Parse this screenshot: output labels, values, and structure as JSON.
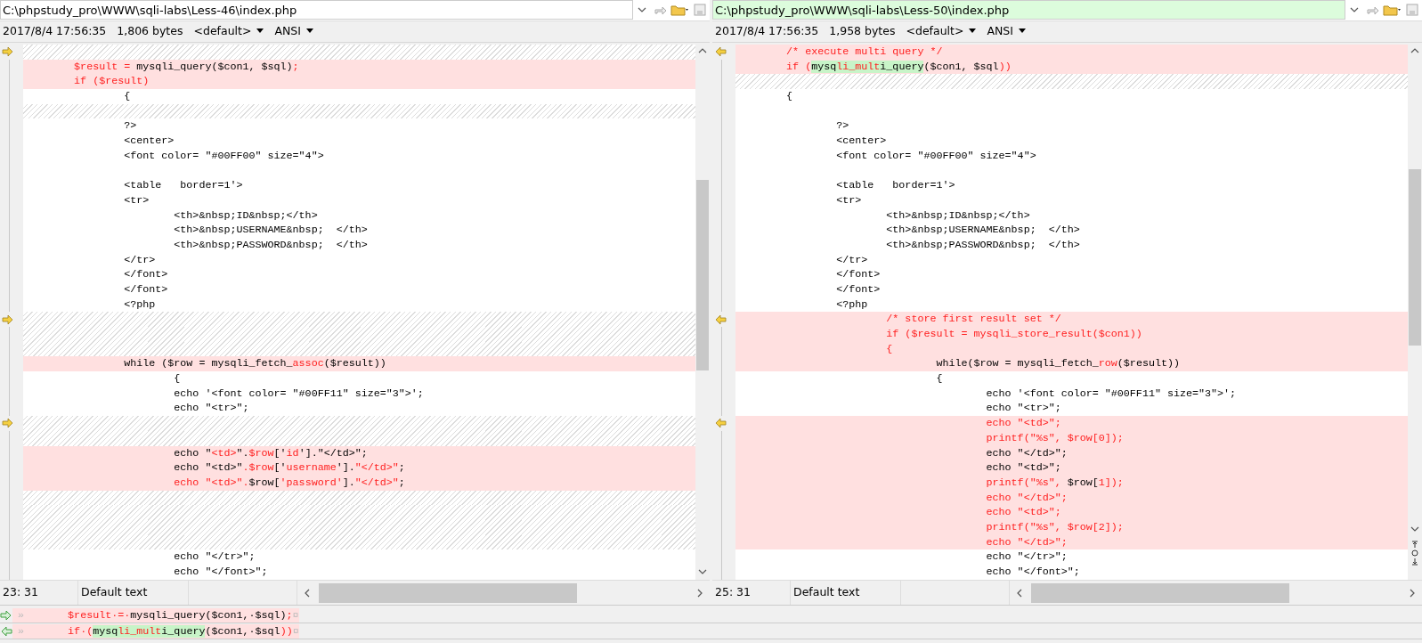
{
  "panes": [
    {
      "path": "C:\\phpstudy_pro\\WWW\\sqli-labs\\Less-46\\index.php",
      "active": false,
      "date": "2017/8/4 17:56:35",
      "size": "1,806 bytes",
      "eol": "<default>",
      "encoding": "ANSI",
      "position": "23: 31",
      "style": "Default text",
      "lines": [
        {
          "kind": "gap",
          "marker": true
        },
        {
          "kind": "diff",
          "marker": false,
          "segments": [
            {
              "text": "\t$result = ",
              "kind": "changed"
            },
            {
              "text": "mysqli_query($con1, $sql)",
              "kind": "plain"
            },
            {
              "text": ";",
              "kind": "changed"
            }
          ]
        },
        {
          "kind": "diff",
          "marker": false,
          "segments": [
            {
              "text": "\tif ($result)",
              "kind": "changed"
            }
          ]
        },
        {
          "kind": "same",
          "marker": false,
          "text": "\t\t{"
        },
        {
          "kind": "gap",
          "marker": false
        },
        {
          "kind": "same",
          "marker": false,
          "text": "\t\t?>"
        },
        {
          "kind": "same",
          "marker": false,
          "text": "\t\t<center>"
        },
        {
          "kind": "same",
          "marker": false,
          "text": "\t\t<font color= \"#00FF00\" size=\"4\">"
        },
        {
          "kind": "same",
          "marker": false
        },
        {
          "kind": "same",
          "marker": false,
          "text": "\t\t<table   border=1'>"
        },
        {
          "kind": "same",
          "marker": false,
          "text": "\t\t<tr>"
        },
        {
          "kind": "same",
          "marker": false,
          "text": "\t\t\t<th>&nbsp;ID&nbsp;</th>"
        },
        {
          "kind": "same",
          "marker": false,
          "text": "\t\t\t<th>&nbsp;USERNAME&nbsp;  </th>"
        },
        {
          "kind": "same",
          "marker": false,
          "text": "\t\t\t<th>&nbsp;PASSWORD&nbsp;  </th>"
        },
        {
          "kind": "same",
          "marker": false,
          "text": "\t\t</tr>"
        },
        {
          "kind": "same",
          "marker": false,
          "text": "\t\t</font>"
        },
        {
          "kind": "same",
          "marker": false,
          "text": "\t\t</font>"
        },
        {
          "kind": "same",
          "marker": false,
          "text": "\t\t<?php"
        },
        {
          "kind": "gap",
          "marker": true
        },
        {
          "kind": "gap",
          "marker": false
        },
        {
          "kind": "gap",
          "marker": false
        },
        {
          "kind": "diff",
          "marker": false,
          "segments": [
            {
              "text": "\t\twhile ($row = mysqli_fetch_",
              "kind": "plain"
            },
            {
              "text": "assoc",
              "kind": "changed"
            },
            {
              "text": "($result))",
              "kind": "plain"
            }
          ]
        },
        {
          "kind": "same",
          "marker": false,
          "text": "\t\t\t{"
        },
        {
          "kind": "same",
          "marker": false,
          "text": "\t\t\techo '<font color= \"#00FF11\" size=\"3\">';"
        },
        {
          "kind": "same",
          "marker": false,
          "text": "\t\t\techo \"<tr>\";"
        },
        {
          "kind": "gap",
          "marker": true
        },
        {
          "kind": "gap",
          "marker": false
        },
        {
          "kind": "diff",
          "marker": false,
          "segments": [
            {
              "text": "\t\t\techo \"",
              "kind": "plain"
            },
            {
              "text": "<td>",
              "kind": "changed"
            },
            {
              "text": "\".",
              "kind": "plain"
            },
            {
              "text": "$row",
              "kind": "changed"
            },
            {
              "text": "['",
              "kind": "plain"
            },
            {
              "text": "id",
              "kind": "changed"
            },
            {
              "text": "'].\"</td>\";",
              "kind": "plain"
            }
          ]
        },
        {
          "kind": "diff",
          "marker": false,
          "segments": [
            {
              "text": "\t\t\techo \"<td>\"",
              "kind": "plain"
            },
            {
              "text": ".$row",
              "kind": "changed"
            },
            {
              "text": "['",
              "kind": "plain"
            },
            {
              "text": "username",
              "kind": "changed"
            },
            {
              "text": "'].",
              "kind": "plain"
            },
            {
              "text": "\"</td>\"",
              "kind": "changed"
            },
            {
              "text": ";",
              "kind": "plain"
            }
          ]
        },
        {
          "kind": "diff",
          "marker": false,
          "segments": [
            {
              "text": "\t\t\techo \"<td>\".",
              "kind": "changed"
            },
            {
              "text": "$row[",
              "kind": "plain"
            },
            {
              "text": "'password'",
              "kind": "changed"
            },
            {
              "text": "].",
              "kind": "plain"
            },
            {
              "text": "\"</td>\"",
              "kind": "changed"
            },
            {
              "text": ";",
              "kind": "plain"
            }
          ]
        },
        {
          "kind": "gap",
          "marker": false
        },
        {
          "kind": "gap",
          "marker": false
        },
        {
          "kind": "gap",
          "marker": false
        },
        {
          "kind": "gap",
          "marker": false
        },
        {
          "kind": "same",
          "marker": false,
          "text": "\t\t\techo \"</tr>\";"
        },
        {
          "kind": "same",
          "marker": false,
          "text": "\t\t\techo \"</font>\";"
        }
      ]
    },
    {
      "path": "C:\\phpstudy_pro\\WWW\\sqli-labs\\Less-50\\index.php",
      "active": true,
      "date": "2017/8/4 17:56:35",
      "size": "1,958 bytes",
      "eol": "<default>",
      "encoding": "ANSI",
      "position": "25: 31",
      "style": "Default text",
      "lines": [
        {
          "kind": "diff",
          "marker": true,
          "segments": [
            {
              "text": "\t/* execute multi query */",
              "kind": "changed"
            }
          ]
        },
        {
          "kind": "diff",
          "marker": false,
          "segments": [
            {
              "text": "\tif (",
              "kind": "changed"
            },
            {
              "text": "mysq",
              "kind": "marked"
            },
            {
              "text": "li_mult",
              "kind": "marked-changed"
            },
            {
              "text": "i_query",
              "kind": "marked"
            },
            {
              "text": "($con1, $sql",
              "kind": "plain"
            },
            {
              "text": "))",
              "kind": "changed"
            }
          ]
        },
        {
          "kind": "gap",
          "marker": false
        },
        {
          "kind": "same",
          "marker": false,
          "text": "\t{"
        },
        {
          "kind": "same",
          "marker": false
        },
        {
          "kind": "same",
          "marker": false,
          "text": "\t\t?>"
        },
        {
          "kind": "same",
          "marker": false,
          "text": "\t\t<center>"
        },
        {
          "kind": "same",
          "marker": false,
          "text": "\t\t<font color= \"#00FF00\" size=\"4\">"
        },
        {
          "kind": "same",
          "marker": false
        },
        {
          "kind": "same",
          "marker": false,
          "text": "\t\t<table   border=1'>"
        },
        {
          "kind": "same",
          "marker": false,
          "text": "\t\t<tr>"
        },
        {
          "kind": "same",
          "marker": false,
          "text": "\t\t\t<th>&nbsp;ID&nbsp;</th>"
        },
        {
          "kind": "same",
          "marker": false,
          "text": "\t\t\t<th>&nbsp;USERNAME&nbsp;  </th>"
        },
        {
          "kind": "same",
          "marker": false,
          "text": "\t\t\t<th>&nbsp;PASSWORD&nbsp;  </th>"
        },
        {
          "kind": "same",
          "marker": false,
          "text": "\t\t</tr>"
        },
        {
          "kind": "same",
          "marker": false,
          "text": "\t\t</font>"
        },
        {
          "kind": "same",
          "marker": false,
          "text": "\t\t</font>"
        },
        {
          "kind": "same",
          "marker": false,
          "text": "\t\t<?php"
        },
        {
          "kind": "diff",
          "marker": true,
          "segments": [
            {
              "text": "\t\t\t/* store first result set */",
              "kind": "changed"
            }
          ]
        },
        {
          "kind": "diff",
          "marker": false,
          "segments": [
            {
              "text": "\t\t\tif ($result = mysqli_store_result($con1))",
              "kind": "changed"
            }
          ]
        },
        {
          "kind": "diff",
          "marker": false,
          "segments": [
            {
              "text": "\t\t\t{",
              "kind": "changed"
            }
          ]
        },
        {
          "kind": "diff",
          "marker": false,
          "segments": [
            {
              "text": "\t\t\t\twhile($row = mysqli_fetch_",
              "kind": "plain"
            },
            {
              "text": "row",
              "kind": "changed"
            },
            {
              "text": "($result))",
              "kind": "plain"
            }
          ]
        },
        {
          "kind": "same",
          "marker": false,
          "text": "\t\t\t\t{"
        },
        {
          "kind": "same",
          "marker": false,
          "text": "\t\t\t\t\techo '<font color= \"#00FF11\" size=\"3\">';"
        },
        {
          "kind": "same",
          "marker": false,
          "text": "\t\t\t\t\techo \"<tr>\";"
        },
        {
          "kind": "diff",
          "marker": true,
          "segments": [
            {
              "text": "\t\t\t\t\techo \"<td>\";",
              "kind": "changed"
            }
          ]
        },
        {
          "kind": "diff",
          "marker": false,
          "segments": [
            {
              "text": "\t\t\t\t\tprintf(\"%s\", $row[0]);",
              "kind": "changed"
            }
          ]
        },
        {
          "kind": "diff",
          "marker": false,
          "segments": [
            {
              "text": "\t\t\t\t\techo \"</td>\";",
              "kind": "plain"
            }
          ]
        },
        {
          "kind": "diff",
          "marker": false,
          "segments": [
            {
              "text": "\t\t\t\t\techo \"<td>\";",
              "kind": "plain"
            }
          ]
        },
        {
          "kind": "diff",
          "marker": false,
          "segments": [
            {
              "text": "\t\t\t\t\tprintf(\"%s\", ",
              "kind": "changed"
            },
            {
              "text": "$row[",
              "kind": "plain"
            },
            {
              "text": "1]);",
              "kind": "changed"
            }
          ]
        },
        {
          "kind": "diff",
          "marker": false,
          "segments": [
            {
              "text": "\t\t\t\t\techo \"</td>\";",
              "kind": "changed"
            }
          ]
        },
        {
          "kind": "diff",
          "marker": false,
          "segments": [
            {
              "text": "\t\t\t\t\techo \"<td>\";",
              "kind": "changed"
            }
          ]
        },
        {
          "kind": "diff",
          "marker": false,
          "segments": [
            {
              "text": "\t\t\t\t\tprintf(\"%s\", $row[2]);",
              "kind": "changed"
            }
          ]
        },
        {
          "kind": "diff",
          "marker": false,
          "segments": [
            {
              "text": "\t\t\t\t\techo \"</td>\";",
              "kind": "changed"
            }
          ]
        },
        {
          "kind": "same",
          "marker": false,
          "text": "\t\t\t\t\techo \"</tr>\";"
        },
        {
          "kind": "same",
          "marker": false,
          "text": "\t\t\t\t\techo \"</font>\";"
        }
      ]
    }
  ],
  "detail_lines": [
    {
      "segments": [
        {
          "text": "»\t",
          "kind": "whitespace"
        },
        {
          "text": "$result·=·",
          "kind": "changed"
        },
        {
          "text": "mysqli_query($con1,·$sql)",
          "kind": "plain"
        },
        {
          "text": ";",
          "kind": "changed"
        },
        {
          "text": "¤",
          "kind": "whitespace"
        }
      ]
    },
    {
      "segments": [
        {
          "text": "»\t",
          "kind": "whitespace"
        },
        {
          "text": "if·(",
          "kind": "changed"
        },
        {
          "text": "mysq",
          "kind": "marked"
        },
        {
          "text": "li_mult",
          "kind": "marked-changed"
        },
        {
          "text": "i_query",
          "kind": "marked"
        },
        {
          "text": "($con1,·$sql",
          "kind": "plain"
        },
        {
          "text": "))",
          "kind": "changed"
        },
        {
          "text": "¤",
          "kind": "whitespace"
        }
      ]
    }
  ]
}
